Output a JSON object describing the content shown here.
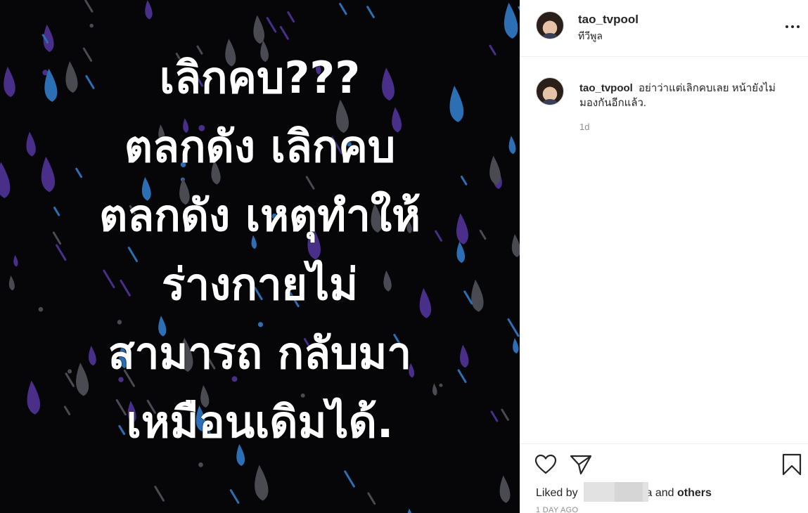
{
  "post": {
    "image_lines": [
      "เลิกคบ???",
      "ตลกดัง  เลิกคบ",
      "ตลกดัง เหตุทำให้",
      "ร่างกายไม่",
      "สามารถ กลับมา",
      "เหมือนเดิมได้."
    ]
  },
  "header": {
    "username": "tao_tvpool",
    "location": "ทีวีพูล",
    "more_icon": "more-horizontal-icon"
  },
  "comment": {
    "username": "tao_tvpool",
    "text": "อย่าว่าแต่เลิกคบเลย หน้ายังไม่มองกันอีกแล้ว.",
    "time": "1d"
  },
  "actions": {
    "like_icon": "heart-icon",
    "share_icon": "paper-plane-icon",
    "save_icon": "bookmark-icon",
    "liked_by_prefix": "Liked by",
    "liked_by_suffix": "a and",
    "liked_by_others": "others",
    "date": "1 DAY AGO"
  },
  "colors": {
    "image_bg": "#060608",
    "drop_blue": "#2d6fb4",
    "drop_purple": "#4a2f8a",
    "drop_gray": "#4a4a52",
    "text_primary": "#262626",
    "text_secondary": "#8e8e8e",
    "divider": "#efefef"
  }
}
